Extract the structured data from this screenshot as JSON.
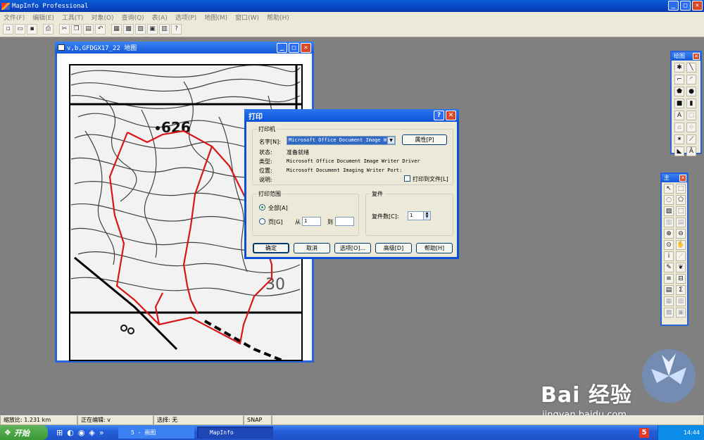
{
  "app": {
    "title": "MapInfo Professional"
  },
  "menubar": {
    "items": [
      "文件(F)",
      "编辑(E)",
      "工具(T)",
      "对象(O)",
      "查询(Q)",
      "表(A)",
      "选项(P)",
      "地图(M)",
      "窗口(W)",
      "帮助(H)"
    ]
  },
  "mapwin": {
    "title": "v,b,GFDGX17_22 地图",
    "label_626": "626",
    "label_30": "30"
  },
  "dialog": {
    "title": "打印",
    "printer_group": "打印机",
    "name_label": "名字[N]:",
    "name_value": "Microsoft Office Document Image Wr",
    "properties_btn": "属性[P]",
    "status_label": "状态:",
    "status_value": "准备就绪",
    "type_label": "类型:",
    "type_value": "Microsoft Office Document Image Writer Driver",
    "where_label": "位置:",
    "where_value": "Microsoft Document Imaging Writer Port:",
    "comment_label": "说明:",
    "print_to_file": "打印到文件[L]",
    "range_group": "打印范围",
    "all_label": "全部[A]",
    "pages_label": "页[G]",
    "from_label": "从",
    "from_value": "1",
    "to_label": "到",
    "to_value": "",
    "copies_group": "复件",
    "copies_label": "复件数[C]:",
    "copies_value": "1",
    "ok_btn": "确定",
    "cancel_btn": "取消",
    "options_btn": "选项[O]...",
    "advanced_btn": "高级[D]",
    "help_btn": "帮助[H]"
  },
  "draw_palette": {
    "title": "绘图"
  },
  "main_palette": {
    "title": "主"
  },
  "statusbar": {
    "zoom": "缩放比: 1.231 km",
    "editing": "正在编辑: v",
    "selection": "选择: 无",
    "snap": "SNAP"
  },
  "taskbar": {
    "start": "开始",
    "task1": "5 - 画图",
    "task2": "MapInfo Professi...",
    "clock": "14:44"
  },
  "watermark": {
    "brand": "Bai 经验",
    "url": "jingyan.baidu.com"
  }
}
